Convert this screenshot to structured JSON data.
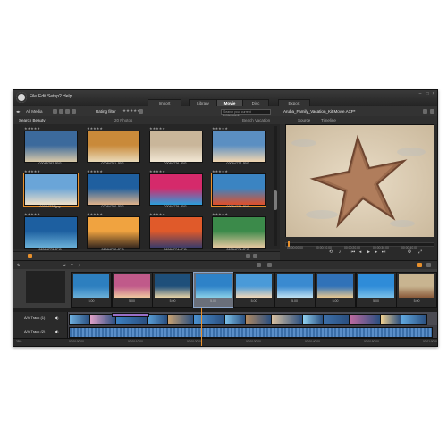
{
  "menu": {
    "file": "File",
    "edit": "Edit",
    "setup": "Setup",
    "help": "? Help"
  },
  "modes": [
    {
      "label": "Import",
      "active": false
    },
    {
      "label": "Library",
      "active": false
    },
    {
      "label": "Movie",
      "active": true
    },
    {
      "label": "Disc",
      "active": false
    },
    {
      "label": "Export",
      "active": false
    }
  ],
  "library": {
    "location": "All Media",
    "rating_label": "Rating filter",
    "search_placeholder": "Search your current folder/media...",
    "collection": "Search Beauty",
    "count": "20 Photos",
    "folder_label": "Beach Vacation"
  },
  "thumbs": [
    {
      "name": "02085782.JPG",
      "colors": [
        "#3c6a9c",
        "#d9c9a8"
      ]
    },
    {
      "name": "02084781.JPG",
      "colors": [
        "#c98a3a",
        "#e9d9b8"
      ]
    },
    {
      "name": "02084776.JPG",
      "colors": [
        "#c9b69a",
        "#f1e7d4"
      ]
    },
    {
      "name": "02084777.JPG",
      "colors": [
        "#5b8fc2",
        "#f1d6b0"
      ]
    },
    {
      "name": "02084778.jpg",
      "colors": [
        "#6aa5d8",
        "#efe0c8"
      ]
    },
    {
      "name": "02084780.JPG",
      "colors": [
        "#1f5f9f",
        "#e1b38a"
      ]
    },
    {
      "name": "02084779.JPG",
      "colors": [
        "#d52a6b",
        "#2a9fdc"
      ]
    },
    {
      "name": "02084775.JPG",
      "colors": [
        "#3b84c2",
        "#e04f2a"
      ]
    },
    {
      "name": "02084773.JPG",
      "colors": [
        "#1d5fa0",
        "#6ab0d8"
      ]
    },
    {
      "name": "02084772.JPG",
      "colors": [
        "#f0a340",
        "#3a2a1f"
      ]
    },
    {
      "name": "02084774.JPG",
      "colors": [
        "#e05a2a",
        "#3b3b6a"
      ]
    },
    {
      "name": "02084771.JPG",
      "colors": [
        "#3b8a4a",
        "#e6c8a0"
      ]
    }
  ],
  "preview": {
    "filename": "Aruba_Family_Vacation_Kit.Movie.AXP*",
    "tab_source": "Source",
    "tab_timeline": "Timeline",
    "timecodes": [
      "00:00:00.00",
      "00:00:10.00",
      "00:00:20.00",
      "00:00:30.00",
      "00:00:40.00"
    ],
    "position": 0.02
  },
  "storyboard": [
    {
      "dur": "5.00",
      "colors": [
        "#2d7fbf",
        "#6bb0d8"
      ]
    },
    {
      "dur": "5.00",
      "colors": [
        "#c05a8a",
        "#f0c8a0"
      ]
    },
    {
      "dur": "5.00",
      "colors": [
        "#1e4f7a",
        "#e8d3a6"
      ]
    },
    {
      "dur": "5.00",
      "colors": [
        "#2e82c8",
        "#8ad0e8"
      ],
      "selected": true
    },
    {
      "dur": "5.00",
      "colors": [
        "#4a9ad8",
        "#f2d8b8"
      ]
    },
    {
      "dur": "5.00",
      "colors": [
        "#3a8ad0",
        "#bfe1f2"
      ]
    },
    {
      "dur": "5.00",
      "colors": [
        "#3172b8",
        "#e8c890"
      ]
    },
    {
      "dur": "5.00",
      "colors": [
        "#2f8cd8",
        "#7ac0e8"
      ]
    },
    {
      "dur": "5.00",
      "colors": [
        "#c8b490",
        "#8a5a3a"
      ]
    }
  ],
  "tracks": {
    "a_name": "A/V Track (1)",
    "b_name": "A/V Track (2)"
  },
  "ruler": [
    "00:00:00.00",
    "00:00:10.00",
    "00:00:20.00",
    "00:00:30.00",
    "00:00:40.00",
    "00:00:50.00",
    "00:01:00.00"
  ],
  "zoom": "25%"
}
